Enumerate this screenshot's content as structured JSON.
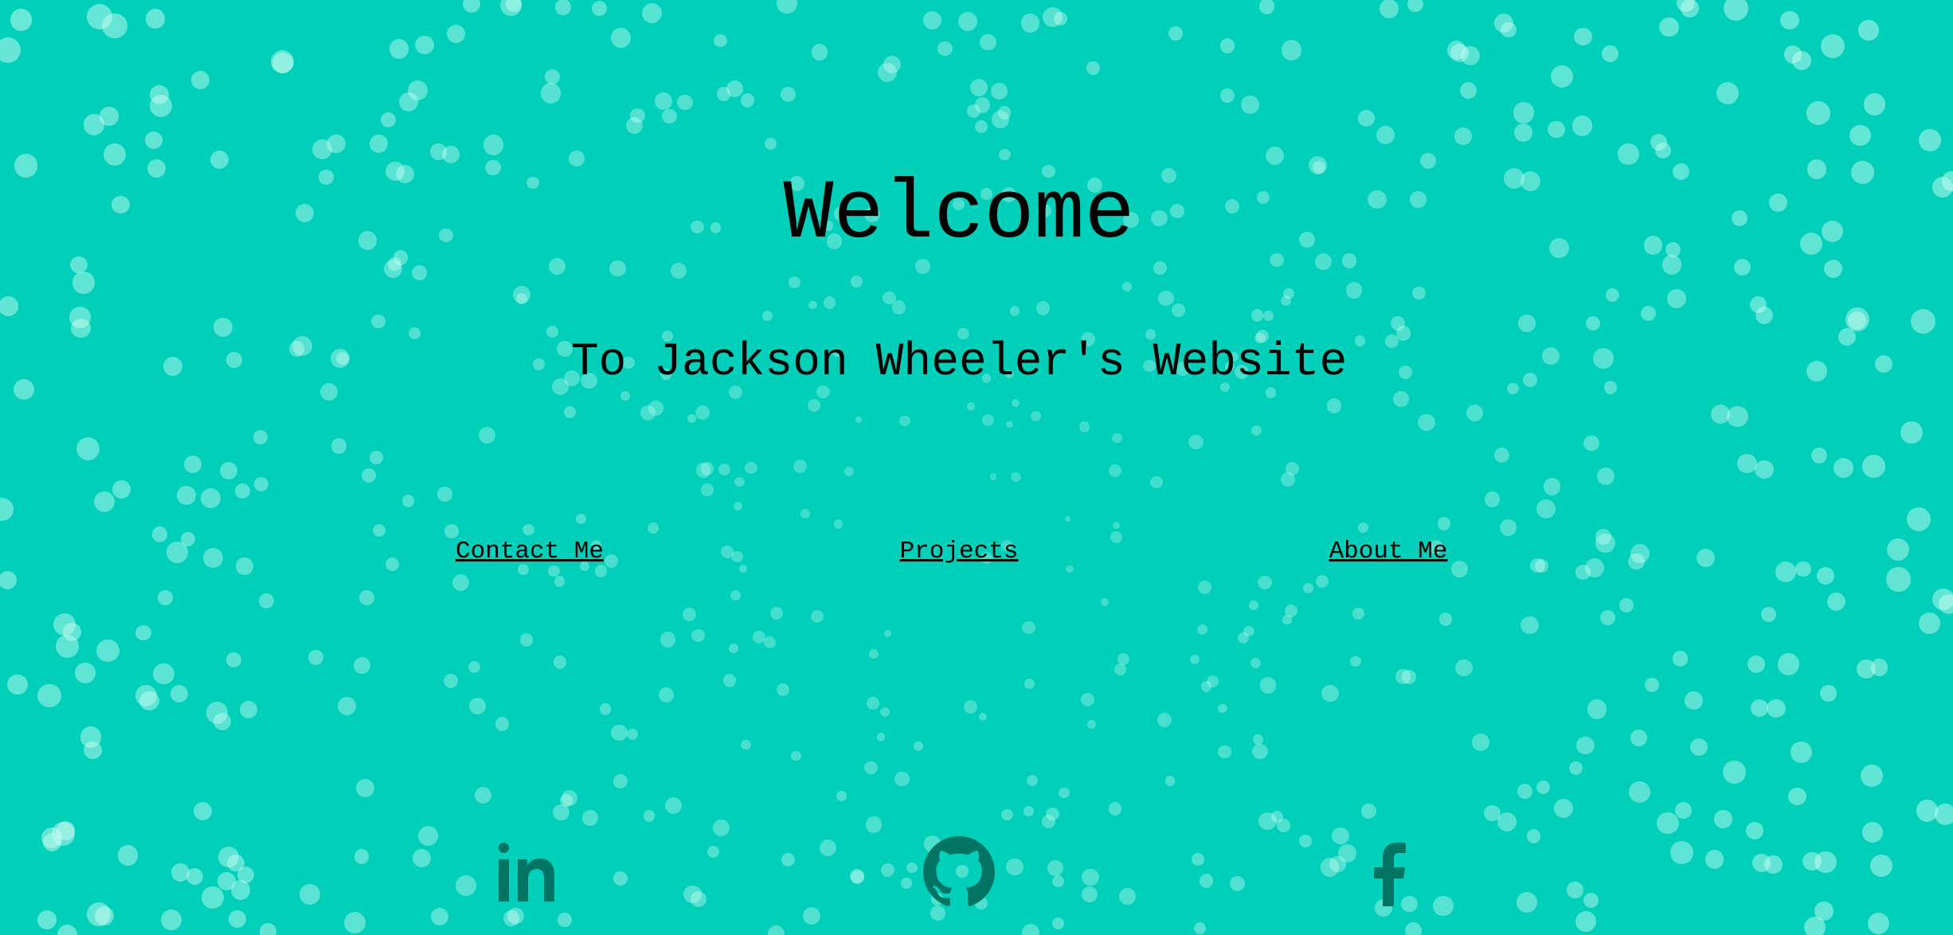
{
  "page": {
    "title": "Welcome",
    "subtitle": "To Jackson Wheeler's Website"
  },
  "nav": [
    {
      "label": "Contact Me"
    },
    {
      "label": "Projects"
    },
    {
      "label": "About Me"
    }
  ],
  "social": [
    {
      "icon": "linkedin-icon"
    },
    {
      "icon": "github-icon"
    },
    {
      "icon": "facebook-icon"
    }
  ],
  "colors": {
    "background": "#00cfba",
    "bubble": "#d2fff5",
    "social_icon": "#027464",
    "text": "#000000"
  }
}
